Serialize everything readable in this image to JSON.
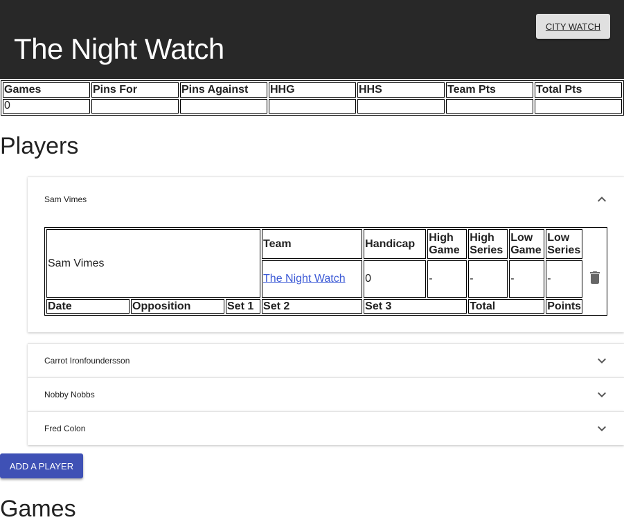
{
  "header": {
    "title": "The Night Watch",
    "nav_button": "City Watch"
  },
  "summary": {
    "headers": [
      "Games",
      "Pins For",
      "Pins Against",
      "HHG",
      "HHS",
      "Team Pts",
      "Total Pts"
    ],
    "values": [
      "0",
      "",
      "",
      "",
      "",
      "",
      ""
    ]
  },
  "players_section": {
    "title": "Players",
    "players": [
      {
        "name": "Sam Vimes",
        "expanded": true
      },
      {
        "name": "Carrot Ironfoundersson",
        "expanded": false
      },
      {
        "name": "Nobby Nobbs",
        "expanded": false
      },
      {
        "name": "Fred Colon",
        "expanded": false
      }
    ],
    "detail": {
      "name": "Sam Vimes",
      "stat_headers": [
        "Team",
        "Handicap",
        "High Game",
        "High Series",
        "Low Game",
        "Low Series"
      ],
      "team": "The Night Watch",
      "handicap": "0",
      "high_game": "-",
      "high_series": "-",
      "low_game": "-",
      "low_series": "-",
      "game_headers": [
        "Date",
        "Opposition",
        "Set 1",
        "Set 2",
        "Set 3",
        "Total",
        "Points"
      ]
    },
    "add_button": "Add a player"
  },
  "games_section": {
    "title": "Games"
  },
  "colors": {
    "header_bg": "#282828",
    "primary": "#3f51b5",
    "link": "#3c5ad6"
  }
}
